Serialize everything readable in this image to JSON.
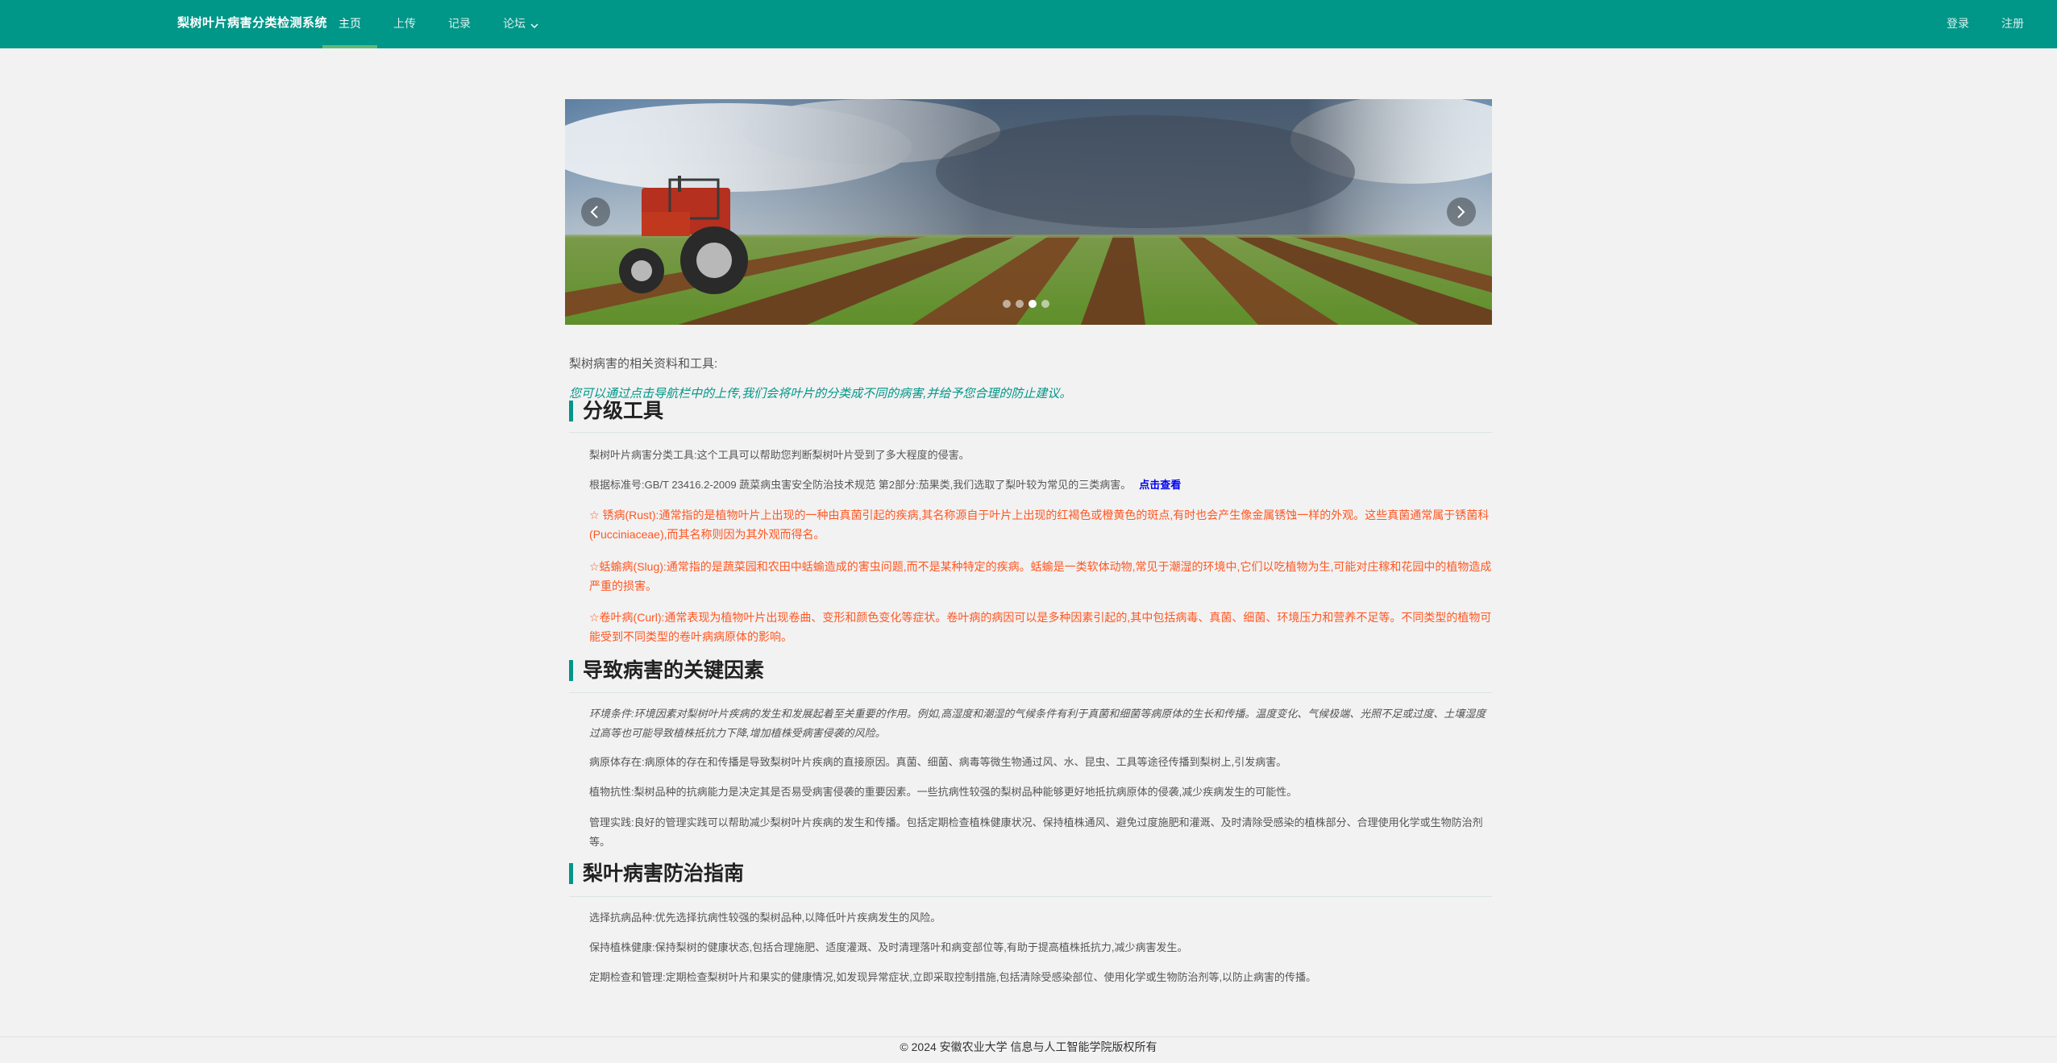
{
  "header": {
    "brand": "梨树叶片病害分类检测系统",
    "nav": [
      "主页",
      "上传",
      "记录",
      "论坛"
    ],
    "right": [
      "登录",
      "注册"
    ]
  },
  "carousel": {
    "slide_count": 4,
    "active_index": 2
  },
  "intro": "梨树病害的相关资料和工具:",
  "tip": "您可以通过点击导航栏中的上传,我们会将叶片的分类成不同的病害,并给予您合理的防止建议。",
  "sections": [
    {
      "title": "分级工具",
      "paragraphs": [
        "梨树叶片病害分类工具:这个工具可以帮助您判断梨树叶片受到了多大程度的侵害。",
        "根据标准号:GB/T 23416.2-2009 蔬菜病虫害安全防治技术规范 第2部分:茄果类,我们选取了梨叶较为常见的三类病害。",
        "☆ 锈病(Rust):通常指的是植物叶片上出现的一种由真菌引起的疾病,其名称源自于叶片上出现的红褐色或橙黄色的斑点,有时也会产生像金属锈蚀一样的外观。这些真菌通常属于锈菌科(Pucciniaceae),而其名称则因为其外观而得名。",
        "☆蛞蝓病(Slug):通常指的是蔬菜园和农田中蛞蝓造成的害虫问题,而不是某种特定的疾病。蛞蝓是一类软体动物,常见于潮湿的环境中,它们以吃植物为生,可能对庄稼和花园中的植物造成严重的损害。",
        "☆卷叶病(Curl):通常表现为植物叶片出现卷曲、变形和颜色变化等症状。卷叶病的病因可以是多种因素引起的,其中包括病毒、真菌、细菌、环境压力和营养不足等。不同类型的植物可能受到不同类型的卷叶病病原体的影响。"
      ],
      "link": "点击查看"
    },
    {
      "title": "导致病害的关键因素",
      "paragraphs": [
        "环境条件:环境因素对梨树叶片疾病的发生和发展起着至关重要的作用。例如,高湿度和潮湿的气候条件有利于真菌和细菌等病原体的生长和传播。温度变化、气候极端、光照不足或过度、土壤湿度过高等也可能导致植株抵抗力下降,增加植株受病害侵袭的风险。",
        "病原体存在:病原体的存在和传播是导致梨树叶片疾病的直接原因。真菌、细菌、病毒等微生物通过风、水、昆虫、工具等途径传播到梨树上,引发病害。",
        "植物抗性:梨树品种的抗病能力是决定其是否易受病害侵袭的重要因素。一些抗病性较强的梨树品种能够更好地抵抗病原体的侵袭,减少疾病发生的可能性。",
        "管理实践:良好的管理实践可以帮助减少梨树叶片疾病的发生和传播。包括定期检查植株健康状况、保持植株通风、避免过度施肥和灌溉、及时清除受感染的植株部分、合理使用化学或生物防治剂等。"
      ]
    },
    {
      "title": "梨叶病害防治指南",
      "paragraphs": [
        "选择抗病品种:优先选择抗病性较强的梨树品种,以降低叶片疾病发生的风险。",
        "保持植株健康:保持梨树的健康状态,包括合理施肥、适度灌溉、及时清理落叶和病变部位等,有助于提高植株抵抗力,减少病害发生。",
        "定期检查和管理:定期检查梨树叶片和果实的健康情况,如发现异常症状,立即采取控制措施,包括清除受感染部位、使用化学或生物防治剂等,以防止病害的传播。"
      ]
    }
  ],
  "footer": "© 2024 安徽农业大学   信息与人工智能学院版权所有",
  "colors": {
    "primary": "#009688",
    "accent": "#5fb878",
    "warning": "#ff5722",
    "link": "#0000ee"
  }
}
